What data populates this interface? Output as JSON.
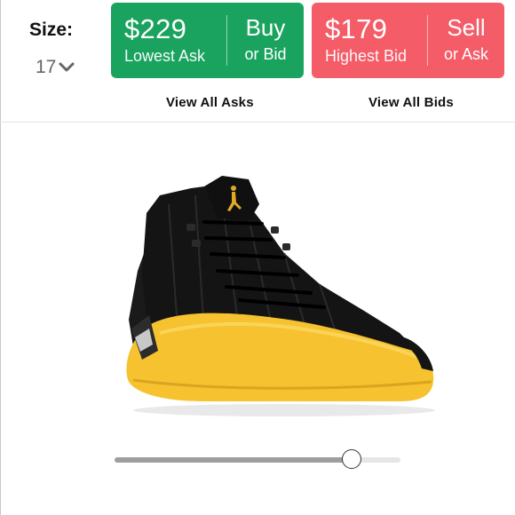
{
  "size": {
    "label": "Size:",
    "value": "17",
    "icon": "chevron-down-icon"
  },
  "lowest_ask": {
    "price": "$229",
    "caption": "Lowest Ask",
    "action": "Buy",
    "action_sub": "or Bid",
    "color": "#1aa35f"
  },
  "highest_bid": {
    "price": "$179",
    "caption": "Highest Bid",
    "action": "Sell",
    "action_sub": "or Ask",
    "color": "#f45c68"
  },
  "links": {
    "view_asks": "View All Asks",
    "view_bids": "View All Bids"
  },
  "product": {
    "image": "sneaker-photo",
    "colors": {
      "upper": "#141414",
      "midsole": "#f6c230"
    }
  },
  "viewer_slider": {
    "value": 0.83
  }
}
